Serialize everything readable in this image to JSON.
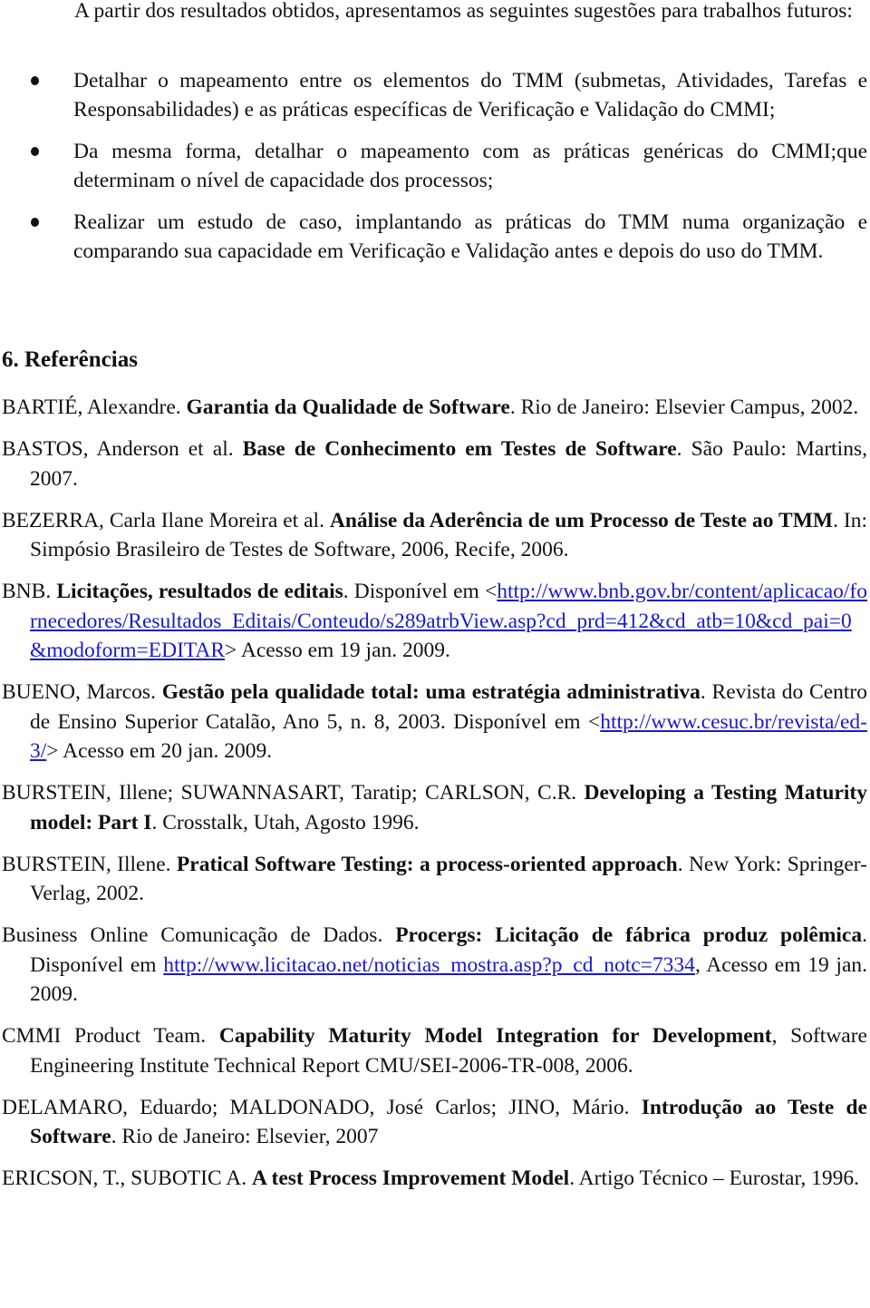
{
  "intro": "A partir dos resultados obtidos, apresentamos as seguintes sugestões para trabalhos futuros:",
  "bullets": [
    "Detalhar o mapeamento entre os elementos do TMM (submetas, Atividades, Tarefas e Responsabilidades) e as práticas específicas de Verificação e Validação do CMMI;",
    "Da mesma forma, detalhar o mapeamento com as práticas genéricas do CMMI;que determinam o nível de capacidade dos processos;",
    "Realizar um estudo de caso, implantando as práticas do TMM numa organização e comparando sua capacidade em Verificação e Validação antes e depois do uso do TMM."
  ],
  "section_heading": "6. Referências",
  "link_color": "#1a1acc",
  "references": [
    {
      "pre": "BARTIÉ, Alexandre. ",
      "title": "Garantia da Qualidade de Software",
      "post": ". Rio de Janeiro: Elsevier Campus, 2002."
    },
    {
      "pre": "BASTOS, Anderson et al. ",
      "title": "Base de Conhecimento em Testes de Software",
      "post": ". São Paulo: Martins, 2007."
    },
    {
      "pre": "BEZERRA, Carla Ilane Moreira et al. ",
      "title": "Análise da Aderência de um Processo de Teste ao TMM",
      "post": ". In: Simpósio Brasileiro de Testes de Software, 2006, Recife, 2006."
    },
    {
      "pre": "BNB. ",
      "title": "Licitações, resultados de editais",
      "mid": ". Disponível em <",
      "link": "http://www.bnb.gov.br/content/aplicacao/fornecedores/Resultados_Editais/Conteudo/s289atrbView.asp?cd_prd=412&cd_atb=10&cd_pai=0&modoform=EDITAR",
      "post": "> Acesso em 19 jan. 2009."
    },
    {
      "pre": "BUENO, Marcos. ",
      "title": "Gestão pela qualidade total: uma estratégia administrativa",
      "mid": ". Revista do Centro de Ensino Superior Catalão, Ano 5, n. 8, 2003. Disponível em <",
      "link": "http://www.cesuc.br/revista/ed-3/",
      "post": "> Acesso em 20 jan. 2009."
    },
    {
      "pre": "BURSTEIN, Illene; SUWANNASART, Taratip; CARLSON, C.R. ",
      "title": "Developing a Testing Maturity model: Part I",
      "post": ". Crosstalk, Utah, Agosto 1996."
    },
    {
      "pre": "BURSTEIN, Illene. ",
      "title": "Pratical Software Testing: a process-oriented approach",
      "post": ". New York: Springer-Verlag, 2002."
    },
    {
      "pre": "Business Online Comunicação de Dados. ",
      "title": "Procergs: Licitação de fábrica produz polêmica",
      "mid": ". Disponível em ",
      "link": "http://www.licitacao.net/noticias_mostra.asp?p_cd_notc=7334",
      "post": ", Acesso em 19 jan. 2009."
    },
    {
      "pre": "CMMI Product Team. ",
      "title": "Capability Maturity Model Integration for Development",
      "post": ", Software Engineering Institute Technical Report CMU/SEI-2006-TR-008, 2006."
    },
    {
      "pre": "DELAMARO, Eduardo; MALDONADO, José Carlos; JINO, Mário. ",
      "title": "Introdução ao Teste de Software",
      "post": ". Rio de Janeiro: Elsevier, 2007"
    },
    {
      "pre": "ERICSON, T., SUBOTIC A. ",
      "title": "A test Process Improvement Model",
      "post": ". Artigo Técnico – Eurostar, 1996."
    }
  ]
}
